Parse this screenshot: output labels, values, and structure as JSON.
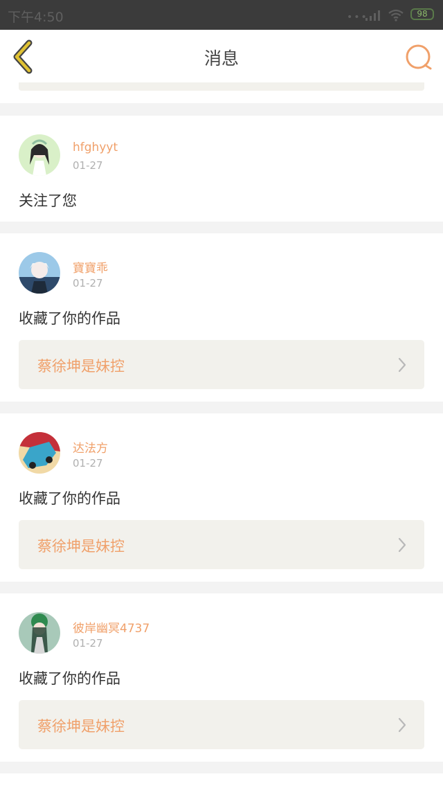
{
  "status_bar": {
    "time": "下午4:50",
    "battery": "98"
  },
  "nav": {
    "title": "消息"
  },
  "colors": {
    "accent": "#f0a06a",
    "back_arrow": "#e0c233",
    "background": "#f3f3f3"
  },
  "icons": {
    "back": "back-arrow-icon",
    "search": "search-icon",
    "chevron": "chevron-right-icon"
  },
  "messages": [
    {
      "username": "hfghyyt",
      "date": "01-27",
      "action": "关注了您"
    },
    {
      "username": "寶寶乖",
      "date": "01-27",
      "action": "收藏了你的作品",
      "work": "蔡徐坤是妹控"
    },
    {
      "username": "达法方",
      "date": "01-27",
      "action": "收藏了你的作品",
      "work": "蔡徐坤是妹控"
    },
    {
      "username": "彼岸幽冥4737",
      "date": "01-27",
      "action": "收藏了你的作品",
      "work": "蔡徐坤是妹控"
    }
  ]
}
